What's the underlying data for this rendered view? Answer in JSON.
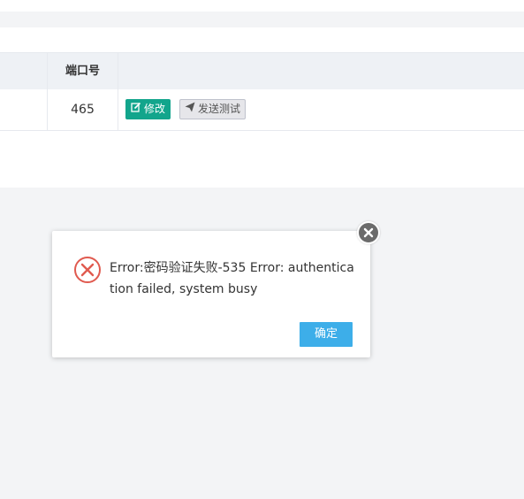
{
  "table": {
    "header": {
      "port": "端口号"
    },
    "row": {
      "port": "465",
      "edit_label": "修改",
      "test_label": "发送测试"
    }
  },
  "dialog": {
    "message": "Error:密码验证失败-535 Error: authentication failed, system busy",
    "ok_label": "确定"
  },
  "colors": {
    "edit_button": "#12a58c",
    "ok_button": "#3daee9",
    "error_icon": "#e05a4f"
  }
}
